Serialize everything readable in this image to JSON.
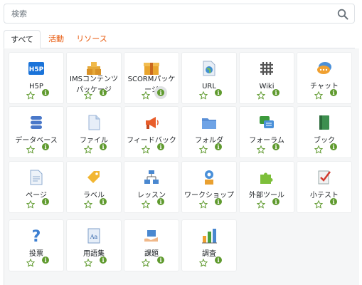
{
  "search": {
    "placeholder": "検索"
  },
  "tabs": [
    {
      "label": "すべて",
      "active": true
    },
    {
      "label": "活動",
      "active": false
    },
    {
      "label": "リソース",
      "active": false
    }
  ],
  "colors": {
    "accent": "#e8590c",
    "star": "#5f9a2e",
    "info": "#5f9a2e"
  },
  "modules": [
    {
      "name": "H5P",
      "lines": [
        "H5P"
      ],
      "icon": "h5p-icon"
    },
    {
      "name": "IMSコンテンツパッケージ",
      "lines": [
        "IMSコンテンツ",
        "パッケージ"
      ],
      "icon": "package-icon"
    },
    {
      "name": "SCORMパッケージ",
      "lines": [
        "SCORMパッケ",
        "ージ"
      ],
      "icon": "box-icon"
    },
    {
      "name": "URL",
      "lines": [
        "URL"
      ],
      "icon": "url-globe-icon"
    },
    {
      "name": "Wiki",
      "lines": [
        "Wiki"
      ],
      "icon": "wiki-icon"
    },
    {
      "name": "チャット",
      "lines": [
        "チャット"
      ],
      "icon": "chat-icon"
    },
    {
      "name": "データベース",
      "lines": [
        "データベース"
      ],
      "icon": "database-icon"
    },
    {
      "name": "ファイル",
      "lines": [
        "ファイル"
      ],
      "icon": "file-icon"
    },
    {
      "name": "フィードバック",
      "lines": [
        "フィードバック"
      ],
      "icon": "megaphone-icon"
    },
    {
      "name": "フォルダ",
      "lines": [
        "フォルダ"
      ],
      "icon": "folder-icon"
    },
    {
      "name": "フォーラム",
      "lines": [
        "フォーラム"
      ],
      "icon": "forum-icon"
    },
    {
      "name": "ブック",
      "lines": [
        "ブック"
      ],
      "icon": "book-icon"
    },
    {
      "name": "ページ",
      "lines": [
        "ページ"
      ],
      "icon": "page-icon"
    },
    {
      "name": "ラベル",
      "lines": [
        "ラベル"
      ],
      "icon": "label-tag-icon"
    },
    {
      "name": "レッスン",
      "lines": [
        "レッスン"
      ],
      "icon": "lesson-icon"
    },
    {
      "name": "ワークショップ",
      "lines": [
        "ワークショップ"
      ],
      "icon": "workshop-icon"
    },
    {
      "name": "外部ツール",
      "lines": [
        "外部ツール"
      ],
      "icon": "puzzle-icon"
    },
    {
      "name": "小テスト",
      "lines": [
        "小テスト"
      ],
      "icon": "quiz-icon"
    },
    {
      "name": "投票",
      "lines": [
        "投票"
      ],
      "icon": "question-icon"
    },
    {
      "name": "用語集",
      "lines": [
        "用語集"
      ],
      "icon": "glossary-icon"
    },
    {
      "name": "課題",
      "lines": [
        "課題"
      ],
      "icon": "assignment-icon"
    },
    {
      "name": "調査",
      "lines": [
        "調査"
      ],
      "icon": "survey-chart-icon"
    }
  ]
}
